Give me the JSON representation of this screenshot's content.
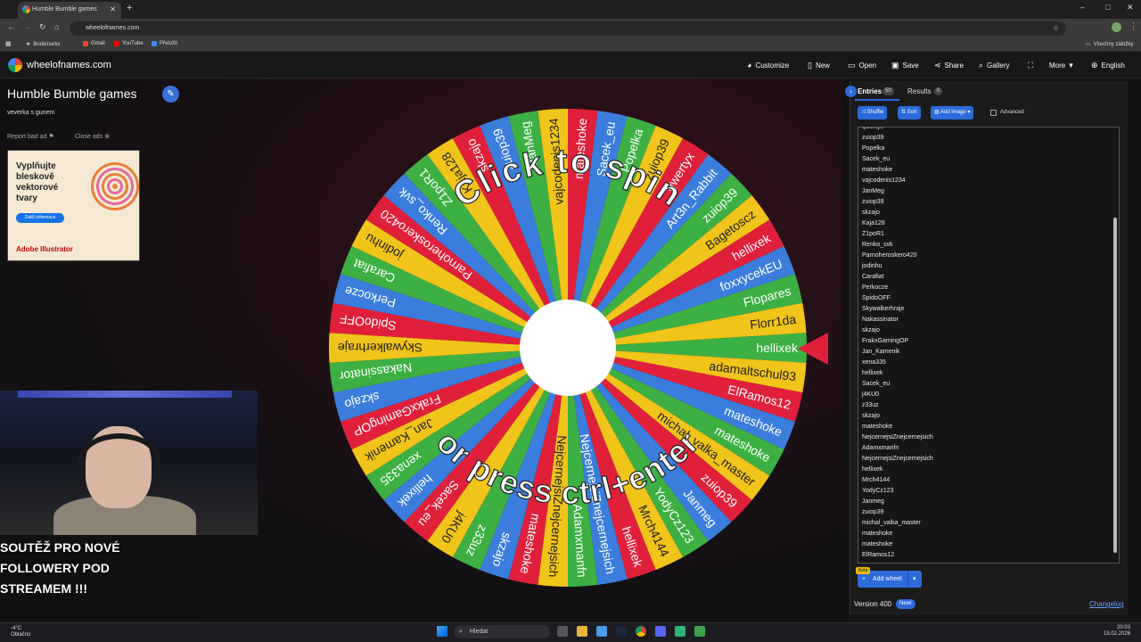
{
  "browser": {
    "tab_title": "Humble Bumble games",
    "url": "wheelofnames.com",
    "bookmarks": [
      "Bookmarks",
      "Gmail",
      "YouTube",
      "Přeložit"
    ],
    "all_bookmarks": "Všechny záložky"
  },
  "header": {
    "site_name": "wheelofnames.com",
    "menu": [
      "Customize",
      "New",
      "Open",
      "Save",
      "Share",
      "Gallery",
      "More",
      "English"
    ]
  },
  "page": {
    "title": "Humble Bumble games",
    "subtitle": "veverka s gunem",
    "report_ad": "Report bad ad",
    "close_ads": "Close ads"
  },
  "ad": {
    "headline": "Vyplňujte bleskově vektorové tvary",
    "button": "Další informace",
    "brand": "Adobe Illustrator"
  },
  "webcam": {
    "overlay_text": "SOUTĚŽ PRO NOVÉ FOLLOWERY POD STREAMEM !!!"
  },
  "wheel": {
    "top_text": "Click to spin",
    "bottom_text": "or press ctrl+enter",
    "segment_colors": [
      "#3cb043",
      "#f0c419",
      "#e0203a",
      "#3b7ddd"
    ],
    "segments": [
      "hellixek",
      "adamaltschul93",
      "ElRamos12",
      "mateshoke",
      "mateshoke",
      "michal_valka_master",
      "zuiop39",
      "Janmeg",
      "YodyCz123",
      "Mrch4144",
      "hellixek",
      "NejcernejsiZnejcernejsich",
      "Adamxmanfn",
      "NejcernejsiZnejcernejsich",
      "mateshoke",
      "skzajo",
      "z33uz",
      "j4KU0",
      "Sacek_eu",
      "hellixek",
      "xena335",
      "Jan_Kamenik",
      "FrakxGamingOP",
      "skzajo",
      "Nakassinator",
      "Skywalkerhraje",
      "SpidoOFF",
      "Perkocze",
      "Carafiat",
      "jodinhu",
      "Parnoheroskero420",
      "Renko_svk",
      "Z1poR1",
      "Kaja128",
      "skzajo",
      "zuiop39",
      "JanMeg",
      "vajcodenis1234",
      "mateshoke",
      "Sacek_eu",
      "Popelka",
      "zuiop39",
      "qwertyx",
      "Art3n_Rabbit",
      "zuiop39",
      "Bagetoscz",
      "hellixek",
      "foxxycekEU",
      "Flopares",
      "Florr1da"
    ]
  },
  "panel": {
    "tab_entries": "Entries",
    "entries_count": "50",
    "tab_results": "Results",
    "results_count": "0",
    "shuffle": "Shuffle",
    "sort": "Sort",
    "add_image": "Add image",
    "advanced": "Advanced",
    "entries": [
      "qwertyx",
      "zuiop39",
      "Popelka",
      "Sacek_eu",
      "mateshoke",
      "vajcodenis1234",
      "JanMeg",
      "zuiop39",
      "skzajo",
      "Kaja128",
      "Z1poR1",
      "Renko_svk",
      "Parnoheroskero420",
      "jodinhu",
      "Carafiat",
      "Perkocze",
      "SpidoOFF",
      "Skywalkerhraje",
      "Nakassinator",
      "skzajo",
      "FrakxGamingOP",
      "Jan_Kamenik",
      "xena335",
      "hellixek",
      "Sacek_eu",
      "j4KU0",
      "z33uz",
      "skzajo",
      "mateshoke",
      "NejcernejsiZnejcernejsich",
      "Adamxmanfn",
      "NejcernejsiZnejcernejsich",
      "hellixek",
      "Mrch4144",
      "YodyCz123",
      "Janmeg",
      "zuiop39",
      "michal_valka_master",
      "mateshoke",
      "mateshoke",
      "ElRamos12"
    ],
    "beta": "Beta",
    "add_wheel": "Add wheel",
    "version": "Version 400",
    "new_badge": "New!",
    "changelog": "Changelog"
  },
  "taskbar": {
    "temperature": "-4°C",
    "weather": "Oblačno",
    "search": "Hledat",
    "time": "20:03",
    "date": "15.02.2026"
  }
}
